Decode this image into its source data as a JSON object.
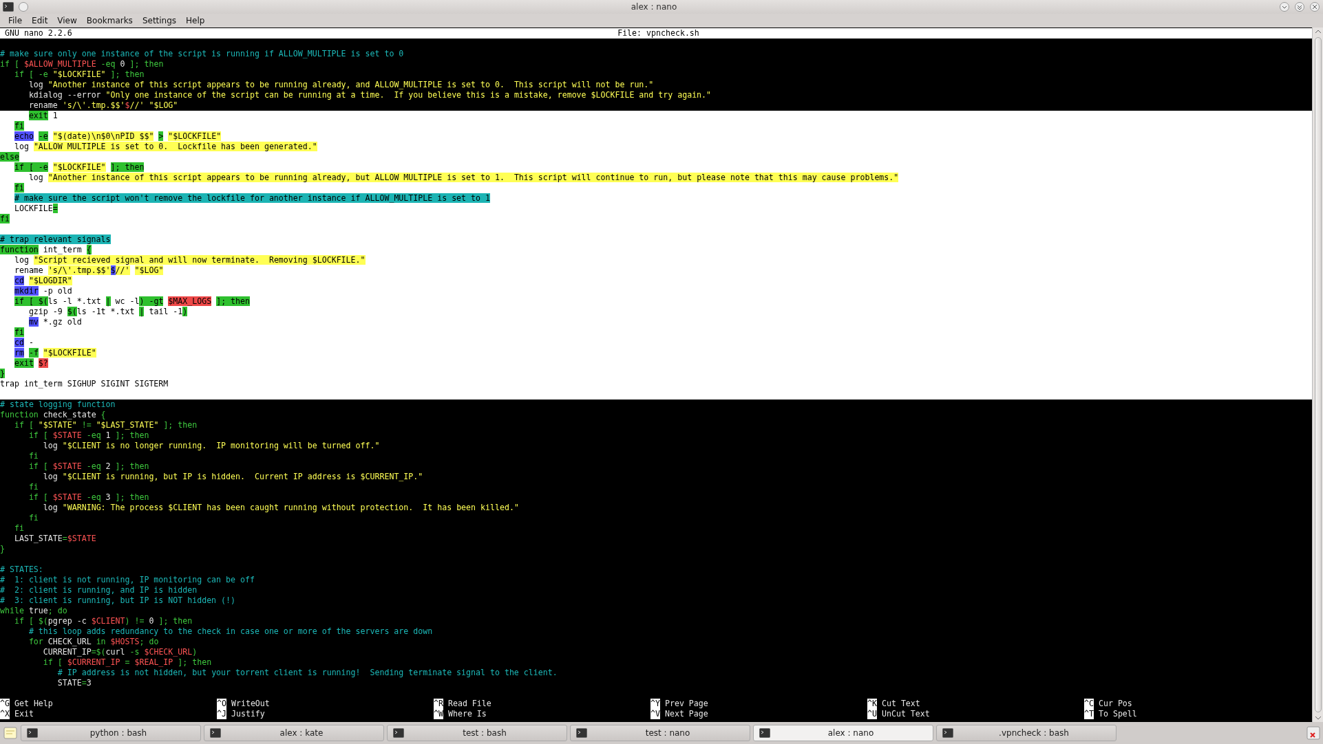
{
  "window": {
    "title": "alex : nano"
  },
  "menu": [
    "File",
    "Edit",
    "View",
    "Bookmarks",
    "Settings",
    "Help"
  ],
  "nano": {
    "version": "GNU nano 2.2.6",
    "file": "File: vpncheck.sh"
  },
  "lines": [
    {
      "highlighted": false
    },
    {
      "highlighted": false,
      "segments": [
        {
          "kind": "comment",
          "text": "# make sure only one instance of the script is running if ALLOW_MULTIPLE is set to 0"
        }
      ]
    },
    {
      "highlighted": false,
      "segments": [
        {
          "kind": "keyword",
          "text": "if [ "
        },
        {
          "kind": "variable",
          "text": "$ALLOW_MULTIPLE"
        },
        {
          "kind": "keyword",
          "text": " -eq "
        },
        {
          "kind": "plain",
          "text": "0"
        },
        {
          "kind": "keyword",
          "text": " ]; then"
        }
      ]
    },
    {
      "highlighted": false,
      "segments": [
        {
          "kind": "keyword",
          "text": "   if [ -e "
        },
        {
          "kind": "string",
          "text": "\"$LOCKFILE\""
        },
        {
          "kind": "keyword",
          "text": " ]; then"
        }
      ]
    },
    {
      "highlighted": false,
      "segments": [
        {
          "kind": "plain",
          "text": "      log "
        },
        {
          "kind": "string",
          "text": "\"Another instance of this script appears to be running already, and ALLOW_MULTIPLE is set to 0.  This script will not be run.\""
        }
      ]
    },
    {
      "highlighted": false,
      "segments": [
        {
          "kind": "plain",
          "text": "      kdialog --error "
        },
        {
          "kind": "string",
          "text": "\"Only one instance of the script can be running at a time.  If you believe this is a mistake, remove $LOCKFILE and try again.\""
        }
      ]
    },
    {
      "highlighted": false,
      "segments": [
        {
          "kind": "plain",
          "text": "      rename "
        },
        {
          "kind": "string",
          "text": "'s/\\'.tmp.$$'"
        },
        {
          "kind": "variable",
          "text": "$"
        },
        {
          "kind": "string",
          "text": "//'"
        },
        {
          "kind": "string",
          "text": " \"$LOG\""
        }
      ]
    },
    {
      "highlighted": true,
      "segments": [
        {
          "kind": "keyword",
          "text": "      exit"
        },
        {
          "kind": "plain",
          "text": " 1"
        }
      ]
    },
    {
      "highlighted": true,
      "segments": [
        {
          "kind": "keyword",
          "text": "   fi"
        }
      ]
    },
    {
      "highlighted": true,
      "segments": [
        {
          "kind": "command",
          "text": "   echo"
        },
        {
          "kind": "keyword",
          "text": " -e"
        },
        {
          "kind": "string",
          "text": " \"$(date)\\n$0\\nPID $$\""
        },
        {
          "kind": "keyword",
          "text": " >"
        },
        {
          "kind": "string",
          "text": " \"$LOCKFILE\""
        }
      ]
    },
    {
      "highlighted": true,
      "segments": [
        {
          "kind": "plain",
          "text": "   log "
        },
        {
          "kind": "string",
          "text": "\"ALLOW MULTIPLE is set to 0.  Lockfile has been generated.\""
        }
      ]
    },
    {
      "highlighted": true,
      "segments": [
        {
          "kind": "keyword",
          "text": "else"
        }
      ]
    },
    {
      "highlighted": true,
      "segments": [
        {
          "kind": "keyword",
          "text": "   if [ -e "
        },
        {
          "kind": "string",
          "text": "\"$LOCKFILE\""
        },
        {
          "kind": "keyword",
          "text": " ]; then"
        }
      ]
    },
    {
      "highlighted": true,
      "segments": [
        {
          "kind": "plain",
          "text": "      log "
        },
        {
          "kind": "string",
          "text": "\"Another instance of this script appears to be running already, but ALLOW MULTIPLE is set to 1.  This script will continue to run, but please note that this may cause problems.\""
        }
      ]
    },
    {
      "highlighted": true,
      "segments": [
        {
          "kind": "keyword",
          "text": "   fi"
        }
      ]
    },
    {
      "highlighted": true,
      "segments": [
        {
          "kind": "comment",
          "text": "   # make sure the script won't remove the lockfile for another instance if ALLOW_MULTIPLE is set to 1"
        }
      ]
    },
    {
      "highlighted": true,
      "segments": [
        {
          "kind": "plain",
          "text": "   LOCKFILE"
        },
        {
          "kind": "keyword",
          "text": "="
        }
      ]
    },
    {
      "highlighted": true,
      "segments": [
        {
          "kind": "keyword",
          "text": "fi"
        }
      ]
    },
    {
      "highlighted": true
    },
    {
      "highlighted": true,
      "segments": [
        {
          "kind": "comment",
          "text": "# trap relevant signals"
        }
      ]
    },
    {
      "highlighted": true,
      "segments": [
        {
          "kind": "keyword",
          "text": "function"
        },
        {
          "kind": "plain",
          "text": " int_term "
        },
        {
          "kind": "keyword",
          "text": "{"
        }
      ]
    },
    {
      "highlighted": true,
      "segments": [
        {
          "kind": "plain",
          "text": "   log "
        },
        {
          "kind": "string",
          "text": "\"Script recieved signal and will now terminate.  Removing $LOCKFILE.\""
        }
      ]
    },
    {
      "highlighted": true,
      "segments": [
        {
          "kind": "plain",
          "text": "   rename "
        },
        {
          "kind": "string",
          "text": "'s/\\'.tmp.$$'"
        },
        {
          "kind": "command",
          "text": "$"
        },
        {
          "kind": "string",
          "text": "//'"
        },
        {
          "kind": "string",
          "text": " \"$LOG\""
        }
      ]
    },
    {
      "highlighted": true,
      "segments": [
        {
          "kind": "command",
          "text": "   cd"
        },
        {
          "kind": "string",
          "text": " \"$LOGDIR\""
        }
      ]
    },
    {
      "highlighted": true,
      "segments": [
        {
          "kind": "command",
          "text": "   mkdir"
        },
        {
          "kind": "plain",
          "text": " -p old"
        }
      ]
    },
    {
      "highlighted": true,
      "segments": [
        {
          "kind": "keyword",
          "text": "   if [ $("
        },
        {
          "kind": "plain",
          "text": "ls -l *.txt "
        },
        {
          "kind": "keyword",
          "text": "|"
        },
        {
          "kind": "plain",
          "text": " wc -l"
        },
        {
          "kind": "keyword",
          "text": ") -gt "
        },
        {
          "kind": "variable",
          "text": "$MAX_LOGS"
        },
        {
          "kind": "keyword",
          "text": " ]; then"
        }
      ]
    },
    {
      "highlighted": true,
      "segments": [
        {
          "kind": "plain",
          "text": "      gzip -9 "
        },
        {
          "kind": "keyword",
          "text": "$("
        },
        {
          "kind": "plain",
          "text": "ls -1t *.txt "
        },
        {
          "kind": "keyword",
          "text": "|"
        },
        {
          "kind": "plain",
          "text": " tail -1"
        },
        {
          "kind": "keyword",
          "text": ")"
        }
      ]
    },
    {
      "highlighted": true,
      "segments": [
        {
          "kind": "command",
          "text": "      mv"
        },
        {
          "kind": "plain",
          "text": " *.gz old"
        }
      ]
    },
    {
      "highlighted": true,
      "segments": [
        {
          "kind": "keyword",
          "text": "   fi"
        }
      ]
    },
    {
      "highlighted": true,
      "segments": [
        {
          "kind": "command",
          "text": "   cd"
        },
        {
          "kind": "plain",
          "text": " -"
        }
      ]
    },
    {
      "highlighted": true,
      "segments": [
        {
          "kind": "command",
          "text": "   rm"
        },
        {
          "kind": "keyword",
          "text": " -f"
        },
        {
          "kind": "string",
          "text": " \"$LOCKFILE\""
        }
      ]
    },
    {
      "highlighted": true,
      "segments": [
        {
          "kind": "keyword",
          "text": "   exit"
        },
        {
          "kind": "variable",
          "text": " $?"
        }
      ]
    },
    {
      "highlighted": true,
      "segments": [
        {
          "kind": "keyword",
          "text": "}"
        }
      ]
    },
    {
      "highlighted": true,
      "segments": [
        {
          "kind": "plain",
          "text": "trap int_term SIGHUP SIGINT SIGTERM"
        }
      ]
    },
    {
      "highlighted": true
    },
    {
      "highlighted": false,
      "segments": [
        {
          "kind": "comment",
          "text": "# state logging function"
        }
      ]
    },
    {
      "highlighted": false,
      "segments": [
        {
          "kind": "keyword",
          "text": "function"
        },
        {
          "kind": "plain",
          "text": " check_state "
        },
        {
          "kind": "keyword",
          "text": "{"
        }
      ]
    },
    {
      "highlighted": false,
      "segments": [
        {
          "kind": "keyword",
          "text": "   if [ "
        },
        {
          "kind": "string",
          "text": "\"$STATE\""
        },
        {
          "kind": "keyword",
          "text": " != "
        },
        {
          "kind": "string",
          "text": "\"$LAST_STATE\""
        },
        {
          "kind": "keyword",
          "text": " ]; then"
        }
      ]
    },
    {
      "highlighted": false,
      "segments": [
        {
          "kind": "keyword",
          "text": "      if [ "
        },
        {
          "kind": "variable",
          "text": "$STATE"
        },
        {
          "kind": "keyword",
          "text": " -eq "
        },
        {
          "kind": "plain",
          "text": "1"
        },
        {
          "kind": "keyword",
          "text": " ]; then"
        }
      ]
    },
    {
      "highlighted": false,
      "segments": [
        {
          "kind": "plain",
          "text": "         log "
        },
        {
          "kind": "string",
          "text": "\"$CLIENT is no longer running.  IP monitoring will be turned off.\""
        }
      ]
    },
    {
      "highlighted": false,
      "segments": [
        {
          "kind": "keyword",
          "text": "      fi"
        }
      ]
    },
    {
      "highlighted": false,
      "segments": [
        {
          "kind": "keyword",
          "text": "      if [ "
        },
        {
          "kind": "variable",
          "text": "$STATE"
        },
        {
          "kind": "keyword",
          "text": " -eq "
        },
        {
          "kind": "plain",
          "text": "2"
        },
        {
          "kind": "keyword",
          "text": " ]; then"
        }
      ]
    },
    {
      "highlighted": false,
      "segments": [
        {
          "kind": "plain",
          "text": "         log "
        },
        {
          "kind": "string",
          "text": "\"$CLIENT is running, but IP is hidden.  Current IP address is $CURRENT_IP.\""
        }
      ]
    },
    {
      "highlighted": false,
      "segments": [
        {
          "kind": "keyword",
          "text": "      fi"
        }
      ]
    },
    {
      "highlighted": false,
      "segments": [
        {
          "kind": "keyword",
          "text": "      if [ "
        },
        {
          "kind": "variable",
          "text": "$STATE"
        },
        {
          "kind": "keyword",
          "text": " -eq "
        },
        {
          "kind": "plain",
          "text": "3"
        },
        {
          "kind": "keyword",
          "text": " ]; then"
        }
      ]
    },
    {
      "highlighted": false,
      "segments": [
        {
          "kind": "plain",
          "text": "         log "
        },
        {
          "kind": "string",
          "text": "\"WARNING: The process $CLIENT has been caught running without protection.  It has been killed.\""
        }
      ]
    },
    {
      "highlighted": false,
      "segments": [
        {
          "kind": "keyword",
          "text": "      fi"
        }
      ]
    },
    {
      "highlighted": false,
      "segments": [
        {
          "kind": "keyword",
          "text": "   fi"
        }
      ]
    },
    {
      "highlighted": false,
      "segments": [
        {
          "kind": "plain",
          "text": "   LAST_STATE"
        },
        {
          "kind": "keyword",
          "text": "="
        },
        {
          "kind": "variable",
          "text": "$STATE"
        }
      ]
    },
    {
      "highlighted": false,
      "segments": [
        {
          "kind": "keyword",
          "text": "}"
        }
      ]
    },
    {
      "highlighted": false
    },
    {
      "highlighted": false,
      "segments": [
        {
          "kind": "comment",
          "text": "# STATES:"
        }
      ]
    },
    {
      "highlighted": false,
      "segments": [
        {
          "kind": "comment",
          "text": "#  1: client is not running, IP monitoring can be off"
        }
      ]
    },
    {
      "highlighted": false,
      "segments": [
        {
          "kind": "comment",
          "text": "#  2: client is running, and IP is hidden"
        }
      ]
    },
    {
      "highlighted": false,
      "segments": [
        {
          "kind": "comment",
          "text": "#  3: client is running, but IP is NOT hidden (!)"
        }
      ]
    },
    {
      "highlighted": false,
      "segments": [
        {
          "kind": "keyword",
          "text": "while"
        },
        {
          "kind": "plain",
          "text": " true"
        },
        {
          "kind": "keyword",
          "text": "; do"
        }
      ]
    },
    {
      "highlighted": false,
      "segments": [
        {
          "kind": "keyword",
          "text": "   if [ $("
        },
        {
          "kind": "plain",
          "text": "pgrep -c "
        },
        {
          "kind": "variable",
          "text": "$CLIENT"
        },
        {
          "kind": "keyword",
          "text": ") != "
        },
        {
          "kind": "plain",
          "text": "0"
        },
        {
          "kind": "keyword",
          "text": " ]; then"
        }
      ]
    },
    {
      "highlighted": false,
      "segments": [
        {
          "kind": "comment",
          "text": "      # this loop adds redundancy to the check in case one or more of the servers are down"
        }
      ]
    },
    {
      "highlighted": false,
      "segments": [
        {
          "kind": "keyword",
          "text": "      for"
        },
        {
          "kind": "plain",
          "text": " CHECK_URL "
        },
        {
          "kind": "keyword",
          "text": "in "
        },
        {
          "kind": "variable",
          "text": "$HOSTS"
        },
        {
          "kind": "keyword",
          "text": "; do"
        }
      ]
    },
    {
      "highlighted": false,
      "segments": [
        {
          "kind": "plain",
          "text": "         CURRENT_IP"
        },
        {
          "kind": "keyword",
          "text": "=$("
        },
        {
          "kind": "plain",
          "text": "curl "
        },
        {
          "kind": "keyword",
          "text": "-s "
        },
        {
          "kind": "variable",
          "text": "$CHECK_URL"
        },
        {
          "kind": "keyword",
          "text": ")"
        }
      ]
    },
    {
      "highlighted": false,
      "segments": [
        {
          "kind": "keyword",
          "text": "         if [ "
        },
        {
          "kind": "variable",
          "text": "$CURRENT_IP"
        },
        {
          "kind": "keyword",
          "text": " = "
        },
        {
          "kind": "variable",
          "text": "$REAL_IP"
        },
        {
          "kind": "keyword",
          "text": " ]; then"
        }
      ]
    },
    {
      "highlighted": false,
      "segments": [
        {
          "kind": "comment",
          "text": "            # IP address is not hidden, but your torrent client is running!  Sending terminate signal to the client."
        }
      ]
    },
    {
      "highlighted": false,
      "segments": [
        {
          "kind": "plain",
          "text": "            STATE"
        },
        {
          "kind": "keyword",
          "text": "="
        },
        {
          "kind": "plain",
          "text": "3"
        }
      ]
    }
  ],
  "shortcuts": [
    {
      "key": "^G",
      "label": "Get Help"
    },
    {
      "key": "^O",
      "label": "WriteOut"
    },
    {
      "key": "^R",
      "label": "Read File"
    },
    {
      "key": "^Y",
      "label": "Prev Page"
    },
    {
      "key": "^K",
      "label": "Cut Text"
    },
    {
      "key": "^C",
      "label": "Cur Pos"
    },
    {
      "key": "^X",
      "label": "Exit"
    },
    {
      "key": "^J",
      "label": "Justify"
    },
    {
      "key": "^W",
      "label": "Where Is"
    },
    {
      "key": "^V",
      "label": "Next Page"
    },
    {
      "key": "^U",
      "label": "UnCut Text"
    },
    {
      "key": "^T",
      "label": "To Spell"
    }
  ],
  "taskbar": [
    {
      "label": "python : bash",
      "selected": false
    },
    {
      "label": "alex : kate",
      "selected": false
    },
    {
      "label": "test : bash",
      "selected": false
    },
    {
      "label": "test : nano",
      "selected": false
    },
    {
      "label": "alex : nano",
      "selected": true
    },
    {
      "label": ".vpncheck : bash",
      "selected": false
    }
  ]
}
